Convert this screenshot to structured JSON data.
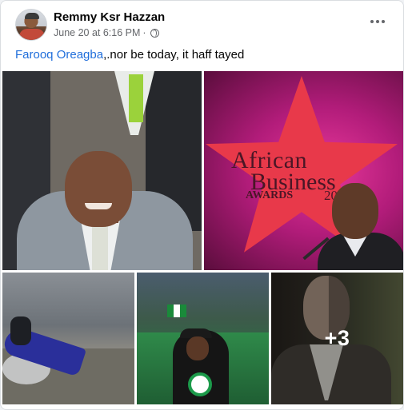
{
  "post": {
    "author": "Remmy Ksr Hazzan",
    "date": "June 20 at 6:16 PM",
    "separator": "·",
    "privacy_icon": "globe-icon",
    "options_icon": "more-options-icon",
    "mention": "Farooq Oreagba",
    "text": ",.nor be today, it haff tayed"
  },
  "photos": {
    "extra_count": "+3",
    "photo2_caption": {
      "line1": "African",
      "line2": "Business",
      "line3": "AWARDS",
      "line4": "2008"
    }
  },
  "colors": {
    "link": "#216fdb",
    "text": "#050505",
    "meta": "#65676b",
    "card_bg": "#ffffff",
    "page_bg": "#f0f2f5"
  }
}
